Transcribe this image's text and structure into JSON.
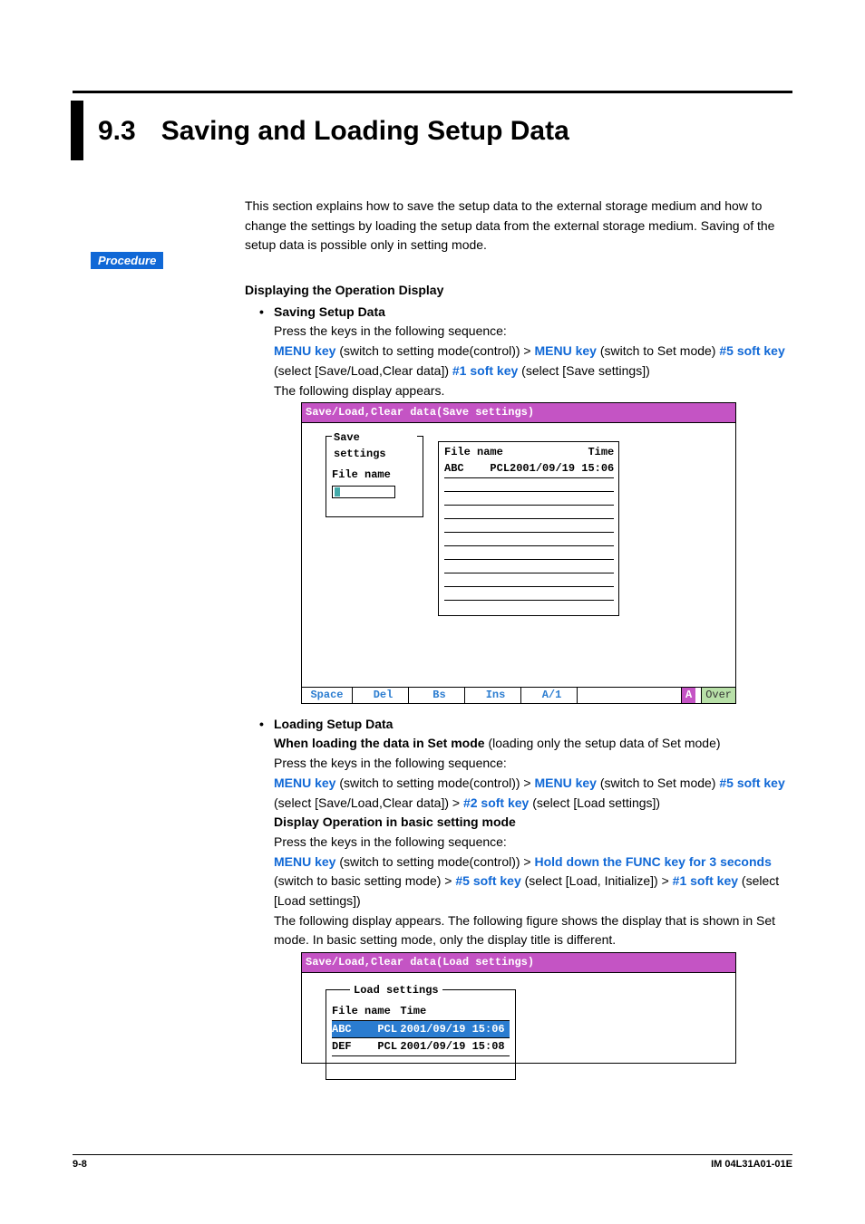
{
  "heading": {
    "number": "9.3",
    "title": "Saving and Loading Setup Data"
  },
  "intro": "This section explains how to save the setup data to the external storage medium and how to change the settings by loading the setup data from the external storage medium. Saving of the setup data is possible only in setting mode.",
  "procedure_label": "Procedure",
  "h2": "Displaying the Operation Display",
  "save": {
    "bullet_title": "Saving Setup Data",
    "line1": "Press the keys in the following sequence:",
    "seq": {
      "a": "MENU key",
      "a_txt": " (switch to setting mode(control)) > ",
      "b": "MENU key",
      "b_txt": " (switch to Set mode) ",
      "c": "#5 soft key",
      "c_txt": " (select [Save/Load,Clear data]) ",
      "d": "#1 soft key",
      "d_txt": " (select [Save settings])"
    },
    "line2": "The following display appears."
  },
  "screen1": {
    "titlebar": "Save/Load,Clear data(Save settings)",
    "left": {
      "legend": "Save settings",
      "label": "File name"
    },
    "right": {
      "h1": "File name",
      "h2": "Time",
      "row": {
        "name": "ABC",
        "ext": "PCL",
        "time": "2001/09/19 15:06"
      }
    },
    "softkeys": {
      "k1": "Space",
      "k2": "Del",
      "k3": "Bs",
      "k4": "Ins",
      "k5": "A/1",
      "ind1": "A",
      "ind2": "Over"
    }
  },
  "load": {
    "bullet_title": "Loading Setup Data",
    "bold_line": "When loading the data in Set mode",
    "bold_line_rest": " (loading only the setup data of Set mode)",
    "line1": "Press the keys in the following sequence:",
    "seq1": {
      "a": "MENU key",
      "a_txt": " (switch to setting mode(control)) > ",
      "b": "MENU key",
      "b_txt": " (switch to Set mode) ",
      "c": "#5 soft key",
      "c_txt": " (select [Save/Load,Clear data]) > ",
      "d": "#2 soft key",
      "d_txt": " (select [Load settings])"
    },
    "h3": "Display Operation in basic setting mode",
    "line2": "Press the keys in the following sequence:",
    "seq2": {
      "a": "MENU key",
      "a_txt": " (switch to setting mode(control)) > ",
      "b": "Hold down the FUNC key for 3 seconds",
      "b_txt": " (switch to basic setting mode) > ",
      "c": "#5 soft key",
      "c_txt": " (select [Load, Initialize]) > ",
      "d": "#1 soft key",
      "d_txt": " (select [Load settings])"
    },
    "line3": "The following display appears.  The following figure shows the display that is shown in Set mode.  In basic setting mode, only the display title is different."
  },
  "screen2": {
    "titlebar": "Save/Load,Clear data(Load settings)",
    "legend": "Load settings",
    "h1": "File name",
    "h2": "Time",
    "rows": [
      {
        "name": "ABC",
        "ext": "PCL",
        "time": "2001/09/19 15:06"
      },
      {
        "name": "DEF",
        "ext": "PCL",
        "time": "2001/09/19 15:08"
      }
    ]
  },
  "footer": {
    "page": "9-8",
    "doc": "IM 04L31A01-01E"
  }
}
